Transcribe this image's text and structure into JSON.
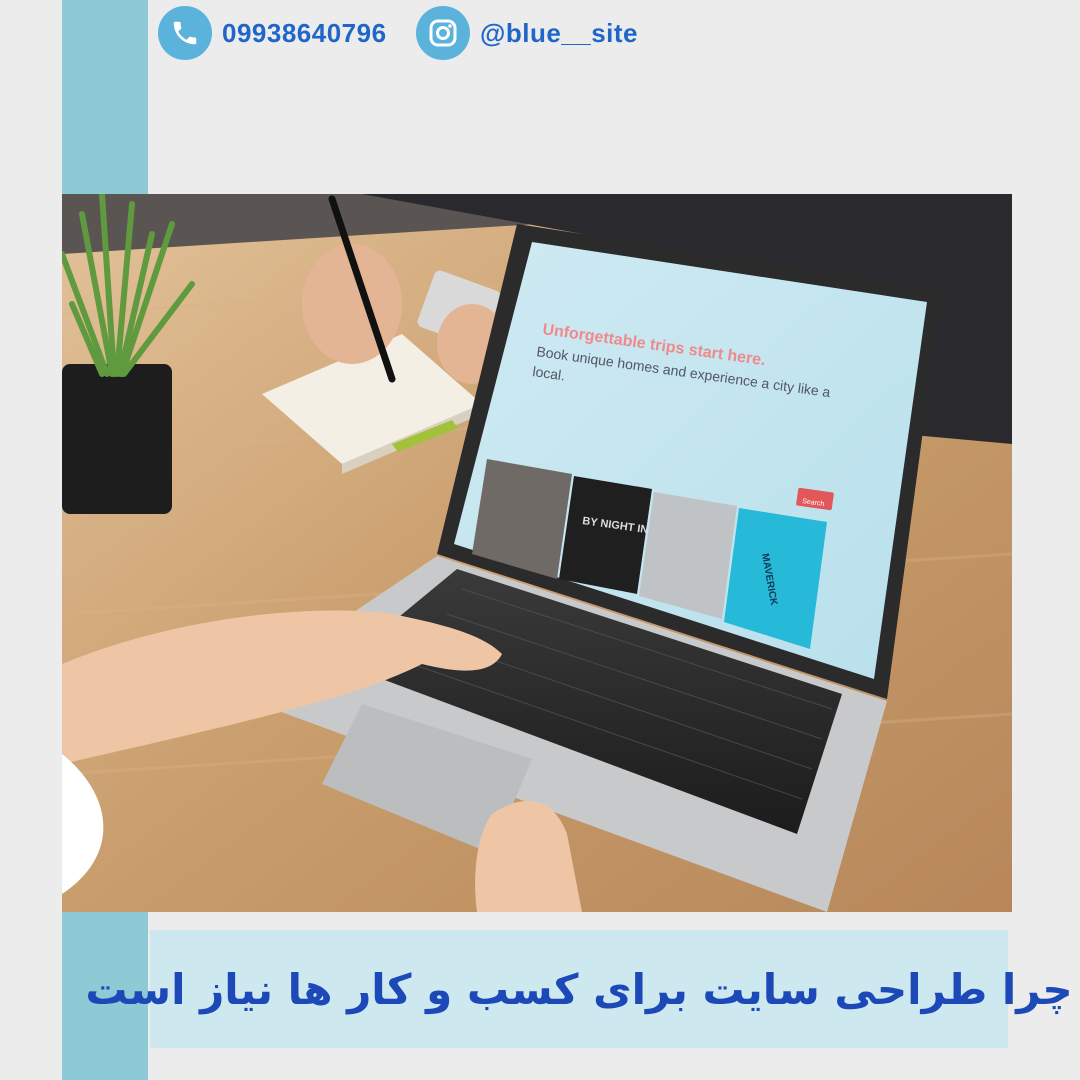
{
  "contact": {
    "phone": "09938640796",
    "instagram": "@blue__site",
    "phone_icon": "phone-icon",
    "instagram_icon": "instagram-icon"
  },
  "photo": {
    "screen_headline": "Unforgettable trips start here.",
    "screen_subline_1": "Book unique homes and experience a city like a",
    "screen_subline_2": "local.",
    "search_button": "Search",
    "card_1_text": "BY NIGHT IN HAVANA",
    "card_2_text": "MAVERICK"
  },
  "caption": "چرا طراحی سایت برای کسب و کار ها نیاز است",
  "colors": {
    "accent": "#8ccbd6",
    "icon_blue": "#5bb3dc",
    "text_blue": "#1f66c8",
    "caption_bg": "#cde8ef",
    "caption_text": "#1d49b8"
  }
}
